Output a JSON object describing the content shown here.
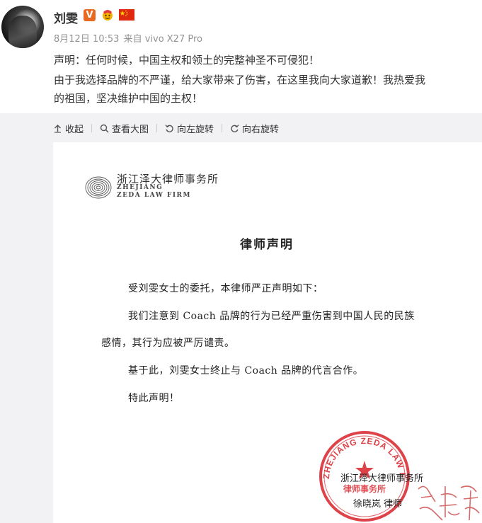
{
  "user": {
    "name": "刘雯",
    "verified_badge": "V",
    "badge_icons": [
      "fan-emoji-icon",
      "china-flag-icon"
    ],
    "time": "8月12日 10:53",
    "source": "来自 vivo X27 Pro"
  },
  "post": {
    "line1": "声明：任何时候，中国主权和领土的完整神圣不可侵犯！",
    "line2": "由于我选择品牌的不严谨，给大家带来了伤害，在这里我向大家道歉！我热爱我",
    "line3": "的祖国，坚决维护中国的主权！"
  },
  "toolbar": {
    "collapse": "收起",
    "view_large": "查看大图",
    "rotate_left": "向左旋转",
    "rotate_right": "向右旋转"
  },
  "document": {
    "firm_cn": "浙江泽大律师事务所",
    "firm_en1": "ZHEJIANG",
    "firm_en2": "ZEDA LAW FIRM",
    "title": "律师声明",
    "para1": "受刘雯女士的委托，本律师严正声明如下：",
    "para2a": "我们注意到 Coach 品牌的行为已经严重伤害到中国人民的民族",
    "para2b": "感情，其行为应被严厉谴责。",
    "para3": "基于此，刘雯女士终止与 Coach 品牌的代言合作。",
    "para4": "特此声明！",
    "sign_firm": "浙江泽大律师事务所",
    "sign_name": "徐晓岚 律师",
    "seal_text": "ZHEJIANG ZEDA LAW FIRM",
    "seal_inner": "律师事务所"
  },
  "colors": {
    "accent_badge": "#e8691f",
    "seal_red": "#d8222a",
    "panel_bg": "#f2f2f5",
    "meta_grey": "#939393"
  }
}
